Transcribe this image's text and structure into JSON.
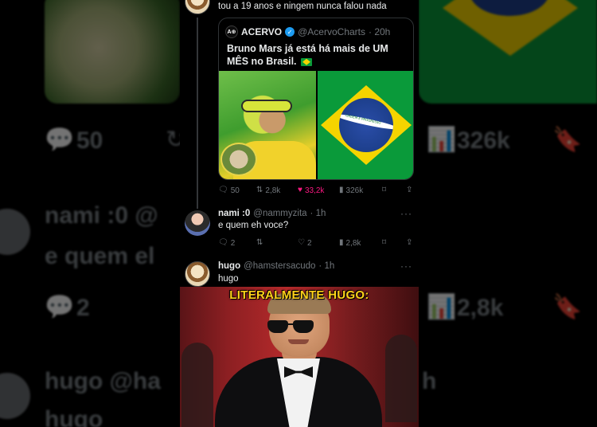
{
  "background": {
    "left_name": "nami :0 @",
    "left_body": "e quem el",
    "left_hugo": "hugo @ha",
    "left_hugo_body": "hugo",
    "left_replies": "50",
    "left_replies2": "2",
    "right_views": "326k",
    "right_views2": "2,8k",
    "right_letter": "h"
  },
  "previous_tweet": {
    "text": "tou a 19 anos e ningem nunca falou nada"
  },
  "quoted_tweet": {
    "logo": "A⊕",
    "name": "ACERVO",
    "handle": "@AcervoCharts",
    "time": "· 20h",
    "text": "Bruno Mars já está há mais de UM MÊS no Brasil.",
    "flag_icon": "brazil-flag-emoji",
    "flag_motto": "ORDEM E PROGRESSO"
  },
  "tweet_actions": {
    "replies": "50",
    "retweets": "2,8k",
    "likes": "33,2k",
    "views": "326k"
  },
  "reply_nami": {
    "name": "nami :0",
    "handle": "@nammyzita",
    "time": "· 1h",
    "text": "e quem eh voce?",
    "replies": "2",
    "retweets": "",
    "likes": "2",
    "views": "2,8k"
  },
  "reply_hugo": {
    "name": "hugo",
    "handle": "@hamstersacudo",
    "time": "· 1h",
    "text": "hugo"
  },
  "meme": {
    "caption": "LITERALMENTE HUGO:"
  },
  "colors": {
    "background": "#000000",
    "text_primary": "#e7e9ea",
    "text_secondary": "#71767b",
    "like_pink": "#f91880",
    "verified_blue": "#1d9bf0",
    "caption_yellow": "#ffd21a"
  },
  "icons": [
    "reply-icon",
    "retweet-icon",
    "like-icon",
    "views-icon",
    "bookmark-icon",
    "share-icon",
    "more-icon",
    "verified-icon"
  ]
}
